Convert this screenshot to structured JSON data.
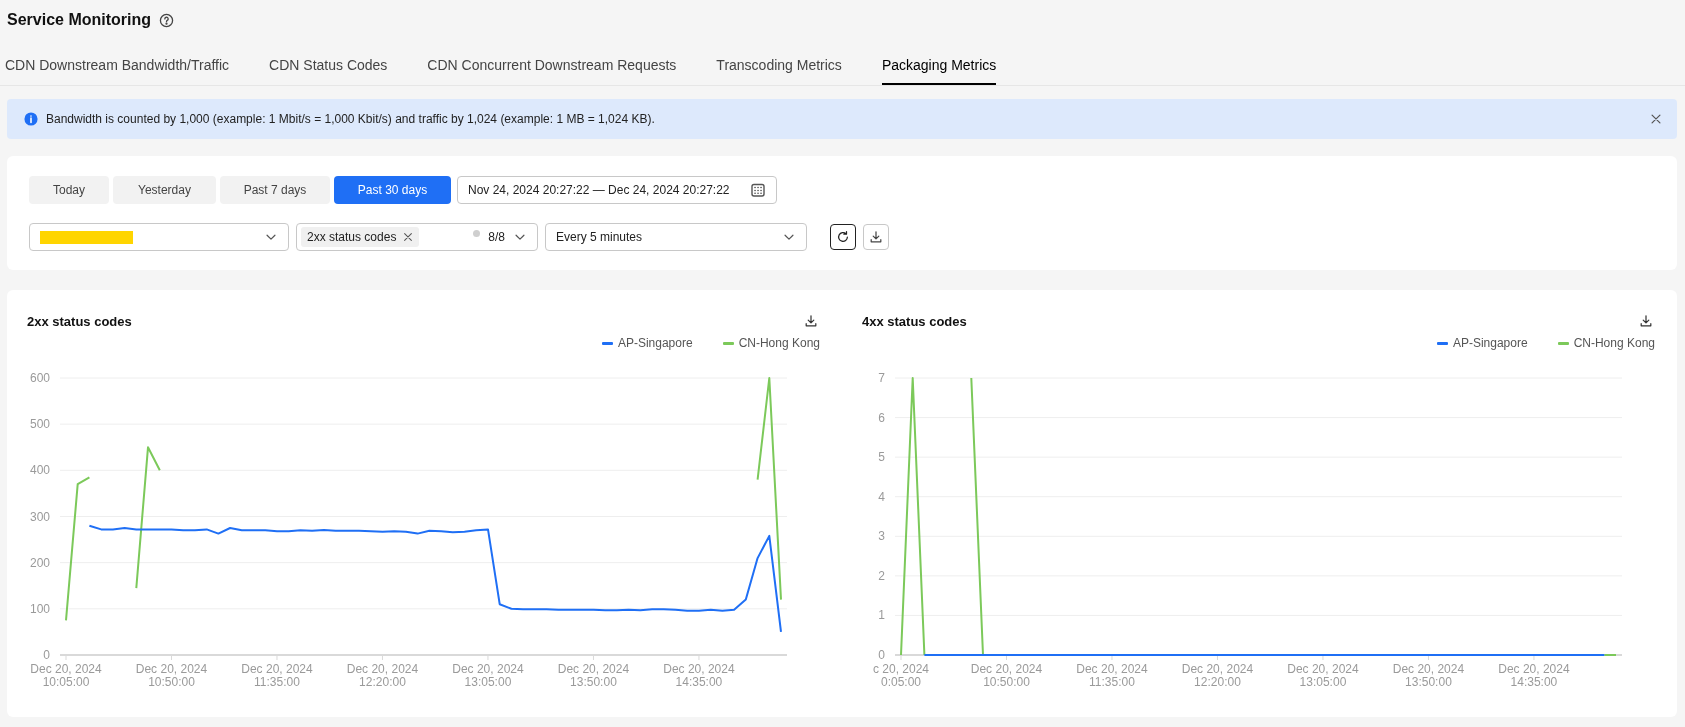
{
  "page": {
    "title": "Service Monitoring"
  },
  "tabs": [
    {
      "label": "CDN Downstream Bandwidth/Traffic",
      "selected": false
    },
    {
      "label": "CDN Status Codes",
      "selected": false
    },
    {
      "label": "CDN Concurrent Downstream Requests",
      "selected": false
    },
    {
      "label": "Transcoding Metrics",
      "selected": false
    },
    {
      "label": "Packaging Metrics",
      "selected": true
    }
  ],
  "notice": {
    "text": "Bandwidth is counted by 1,000 (example: 1 Mbit/s = 1,000 Kbit/s) and traffic by 1,024 (example: 1 MB = 1,024 KB)."
  },
  "filters": {
    "range_buttons": [
      {
        "label": "Today",
        "selected": false
      },
      {
        "label": "Yesterday",
        "selected": false
      },
      {
        "label": "Past 7 days",
        "selected": false
      },
      {
        "label": "Past 30 days",
        "selected": true
      }
    ],
    "date_range": "Nov 24, 2024 20:27:22 — Dec 24, 2024 20:27:22",
    "domain_select": {
      "redacted": true
    },
    "status_select": {
      "tags": [
        "2xx status codes"
      ],
      "count": "8/8"
    },
    "interval_select": {
      "value": "Every 5 minutes"
    }
  },
  "charts": [
    {
      "title": "2xx status codes",
      "chart_data": {
        "type": "line",
        "grid": true,
        "categories": [
          "Dec 20, 2024\n10:05:00",
          null,
          null,
          null,
          null,
          null,
          null,
          null,
          null,
          "Dec 20, 2024\n10:50:00",
          null,
          null,
          null,
          null,
          null,
          null,
          null,
          null,
          "Dec 20, 2024\n11:35:00",
          null,
          null,
          null,
          null,
          null,
          null,
          null,
          null,
          "Dec 20, 2024\n12:20:00",
          null,
          null,
          null,
          null,
          null,
          null,
          null,
          null,
          "Dec 20, 2024\n13:05:00",
          null,
          null,
          null,
          null,
          null,
          null,
          null,
          null,
          "Dec 20, 2024\n13:50:00",
          null,
          null,
          null,
          null,
          null,
          null,
          null,
          null,
          "Dec 20, 2024\n14:35:00",
          null,
          null,
          null,
          null,
          null,
          null,
          null
        ],
        "ylim": [
          0,
          600
        ],
        "yticks": [
          0,
          100,
          200,
          300,
          400,
          500,
          600
        ],
        "series": [
          {
            "name": "AP-Singapore",
            "color": "#1f6ff5",
            "values": [
              null,
              null,
              280,
              272,
              272,
              275,
              272,
              272,
              272,
              272,
              270,
              270,
              272,
              263,
              275,
              270,
              270,
              270,
              268,
              268,
              270,
              269,
              271,
              269,
              269,
              269,
              268,
              267,
              268,
              267,
              263,
              269,
              268,
              266,
              267,
              270,
              272,
              110,
              100,
              99,
              99,
              99,
              98,
              98,
              98,
              98,
              97,
              97,
              98,
              97,
              99,
              99,
              98,
              96,
              96,
              98,
              96,
              98,
              120,
              210,
              258,
              50
            ]
          },
          {
            "name": "CN-Hong Kong",
            "color": "#7cc95a",
            "values": [
              75,
              370,
              385,
              null,
              null,
              null,
              145,
              450,
              400,
              null,
              null,
              null,
              null,
              null,
              null,
              null,
              null,
              null,
              null,
              null,
              null,
              null,
              null,
              null,
              null,
              null,
              null,
              null,
              null,
              null,
              null,
              null,
              null,
              null,
              null,
              null,
              null,
              null,
              null,
              null,
              null,
              null,
              null,
              null,
              null,
              null,
              null,
              null,
              null,
              null,
              null,
              null,
              null,
              null,
              null,
              null,
              null,
              null,
              null,
              380,
              600,
              120
            ]
          }
        ]
      }
    },
    {
      "title": "4xx status codes",
      "chart_data": {
        "type": "line",
        "grid": true,
        "categories": [
          "c 20, 2024\n0:05:00",
          null,
          null,
          null,
          null,
          null,
          null,
          null,
          null,
          "Dec 20, 2024\n10:50:00",
          null,
          null,
          null,
          null,
          null,
          null,
          null,
          null,
          "Dec 20, 2024\n11:35:00",
          null,
          null,
          null,
          null,
          null,
          null,
          null,
          null,
          "Dec 20, 2024\n12:20:00",
          null,
          null,
          null,
          null,
          null,
          null,
          null,
          null,
          "Dec 20, 2024\n13:05:00",
          null,
          null,
          null,
          null,
          null,
          null,
          null,
          null,
          "Dec 20, 2024\n13:50:00",
          null,
          null,
          null,
          null,
          null,
          null,
          null,
          null,
          "Dec 20, 2024\n14:35:00",
          null,
          null,
          null,
          null,
          null,
          null,
          null
        ],
        "ylim": [
          0,
          7
        ],
        "yticks": [
          0,
          1,
          2,
          3,
          4,
          5,
          6,
          7
        ],
        "series": [
          {
            "name": "AP-Singapore",
            "color": "#1f6ff5",
            "values": [
              null,
              null,
              0,
              0,
              0,
              0,
              0,
              0,
              0,
              0,
              0,
              0,
              0,
              0,
              0,
              0,
              0,
              0,
              0,
              0,
              0,
              0,
              0,
              0,
              0,
              0,
              0,
              0,
              0,
              0,
              0,
              0,
              0,
              0,
              0,
              0,
              0,
              0,
              0,
              0,
              0,
              0,
              0,
              0,
              0,
              0,
              0,
              0,
              0,
              0,
              0,
              0,
              0,
              0,
              0,
              0,
              0,
              0,
              0,
              0,
              0,
              null
            ]
          },
          {
            "name": "CN-Hong Kong",
            "color": "#7cc95a",
            "values": [
              0,
              7,
              0,
              null,
              null,
              null,
              7,
              0,
              0,
              null,
              null,
              null,
              null,
              null,
              null,
              null,
              null,
              null,
              null,
              null,
              null,
              null,
              null,
              null,
              null,
              null,
              null,
              null,
              null,
              null,
              null,
              null,
              null,
              null,
              null,
              null,
              null,
              null,
              null,
              null,
              null,
              null,
              null,
              null,
              null,
              null,
              null,
              null,
              null,
              null,
              null,
              null,
              null,
              null,
              null,
              null,
              null,
              null,
              null,
              null,
              0,
              0
            ]
          }
        ]
      }
    }
  ]
}
